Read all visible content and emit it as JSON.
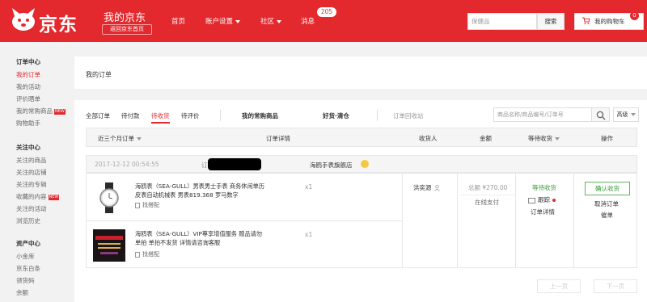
{
  "header": {
    "logo_text": "京东",
    "title": "我的京东",
    "back_home": "返回京东首页",
    "nav": [
      {
        "label": "首页",
        "has_caret": false
      },
      {
        "label": "账户设置",
        "has_caret": true
      },
      {
        "label": "社区",
        "has_caret": true
      },
      {
        "label": "消息",
        "has_caret": false
      }
    ],
    "message_count": "205",
    "search_placeholder": "保健品",
    "search_button": "搜索",
    "cart_label": "我的购物车",
    "cart_count": "0",
    "brand_color": "#e3292d"
  },
  "sidebar": {
    "groups": [
      {
        "title": "订单中心",
        "items": [
          {
            "label": "我的订单",
            "active": true
          },
          {
            "label": "我的活动"
          },
          {
            "label": "评价晒单"
          },
          {
            "label": "我的常购商品",
            "tag": "NEW"
          },
          {
            "label": "购物助手"
          }
        ]
      },
      {
        "title": "关注中心",
        "items": [
          {
            "label": "关注的商品"
          },
          {
            "label": "关注的店铺"
          },
          {
            "label": "关注的专辑"
          },
          {
            "label": "收藏的内容",
            "tag": "NEW"
          },
          {
            "label": "关注的活动"
          },
          {
            "label": "浏览历史"
          }
        ]
      },
      {
        "title": "资产中心",
        "items": [
          {
            "label": "小金库"
          },
          {
            "label": "京东白条"
          },
          {
            "label": "领货码"
          },
          {
            "label": "余额"
          }
        ]
      }
    ]
  },
  "page_title": "我的订单",
  "tabs": [
    {
      "label": "全部订单"
    },
    {
      "label": "待付款"
    },
    {
      "label": "待收货",
      "active": true
    },
    {
      "label": "待评价"
    },
    {
      "label": "我的常购商品",
      "bold": true
    },
    {
      "label": "好货·清仓",
      "bold": true
    },
    {
      "label": "订单回收站"
    }
  ],
  "order_search_placeholder": "商品名称/商品编号/订单号",
  "advanced_label": "高级",
  "table_headers": {
    "period": "近三个月订单",
    "details": "订单详情",
    "receiver": "收货人",
    "amount": "金额",
    "status": "等待收货",
    "action": "操作"
  },
  "order": {
    "date": "2017-12-12 00:54:55",
    "order_no_label": "订单号:",
    "shop": "海鸥手表旗舰店",
    "products": [
      {
        "title": "海鸥表（SEA-GULL）男表男士手表 商务休闲单历皮表自动机械表 男表819.368 罗马数字",
        "similar": "找搭配",
        "qty": "x1"
      },
      {
        "title": "海鸥表（SEA-GULL）VIP尊享增值服务 赠品请勿单拍 单拍不发货 详情请咨询客服",
        "similar": "找搭配",
        "qty": "x1"
      }
    ],
    "receiver": "洪奕源",
    "amount": "总额 ¥270.00",
    "payment": "在线支付",
    "status": "等待收货",
    "track": "跟踪",
    "detail": "订单详情",
    "confirm": "确认收货",
    "cancel": "取消订单",
    "share": "催单"
  },
  "pager": {
    "prev": "上一页",
    "next": "下一页"
  }
}
